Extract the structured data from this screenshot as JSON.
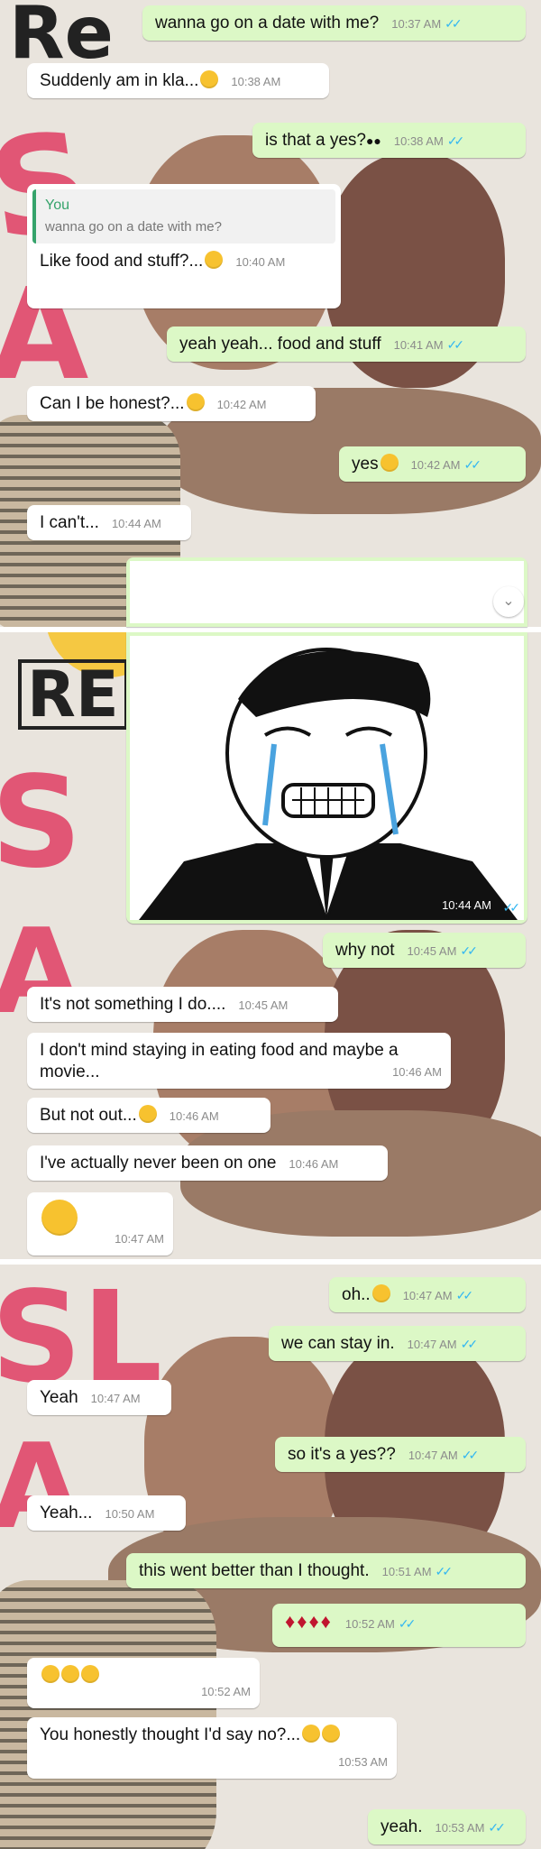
{
  "panels": {
    "wall_text_top": "Re",
    "wall_text_mid": "RE"
  },
  "messages": [
    {
      "dir": "out",
      "text": "wanna go on a date with me?",
      "time": "10:37 AM"
    },
    {
      "dir": "in",
      "text": "Suddenly am in kla...",
      "time": "10:38 AM",
      "emoji": "grinning-sweat"
    },
    {
      "dir": "out",
      "text": "is that a yes?",
      "time": "10:38 AM",
      "emoji": "eyes"
    },
    {
      "dir": "in",
      "quote_author": "You",
      "quote_text": "wanna go on a date with me?",
      "text": "Like food and stuff?...",
      "time": "10:40 AM",
      "emoji": "thinking"
    },
    {
      "dir": "out",
      "text": "yeah yeah... food and stuff",
      "time": "10:41 AM"
    },
    {
      "dir": "in",
      "text": "Can I be honest?...",
      "time": "10:42 AM",
      "emoji": "smile"
    },
    {
      "dir": "out",
      "text": "yes",
      "time": "10:42 AM",
      "emoji": "grinning-sweat"
    },
    {
      "dir": "in",
      "text": "I can't...",
      "time": "10:44 AM"
    },
    {
      "dir": "out",
      "image": "crying-meme-face",
      "time": "10:44 AM"
    },
    {
      "dir": "out",
      "text": "why not",
      "time": "10:45 AM"
    },
    {
      "dir": "in",
      "text": "It's not something I do....",
      "time": "10:45 AM"
    },
    {
      "dir": "in",
      "text": "I don't mind staying in eating food and maybe a movie...",
      "time": "10:46 AM"
    },
    {
      "dir": "in",
      "text": "But not out...",
      "time": "10:46 AM",
      "emoji": "sad-sweat"
    },
    {
      "dir": "in",
      "text": "I've actually never been on one",
      "time": "10:46 AM"
    },
    {
      "dir": "in",
      "text": "",
      "time": "10:47 AM",
      "emoji": "slight-smile"
    },
    {
      "dir": "out",
      "text": "oh..",
      "time": "10:47 AM",
      "emoji": "smile"
    },
    {
      "dir": "out",
      "text": "we can stay in.",
      "time": "10:47 AM"
    },
    {
      "dir": "in",
      "text": "Yeah",
      "time": "10:47 AM"
    },
    {
      "dir": "out",
      "text": "so it's a yes??",
      "time": "10:47 AM"
    },
    {
      "dir": "in",
      "text": "Yeah...",
      "time": "10:50 AM"
    },
    {
      "dir": "out",
      "text": "this went better than I thought.",
      "time": "10:51 AM"
    },
    {
      "dir": "out",
      "text": "",
      "time": "10:52 AM",
      "emoji": "dancers"
    },
    {
      "dir": "in",
      "text": "",
      "time": "10:52 AM",
      "emoji": "laughing-x3"
    },
    {
      "dir": "in",
      "text": "You honestly thought I'd say no?...",
      "time": "10:53 AM",
      "emoji": "laughing-x2"
    },
    {
      "dir": "out",
      "text": "yeah.",
      "time": "10:53 AM"
    }
  ],
  "ticks": "✓✓",
  "scroll_icon": "⌄",
  "colors": {
    "incoming": "#ffffff",
    "outgoing": "#dcf8c6",
    "read_ticks": "#34b7f1",
    "wall_red": "#e1476a"
  }
}
